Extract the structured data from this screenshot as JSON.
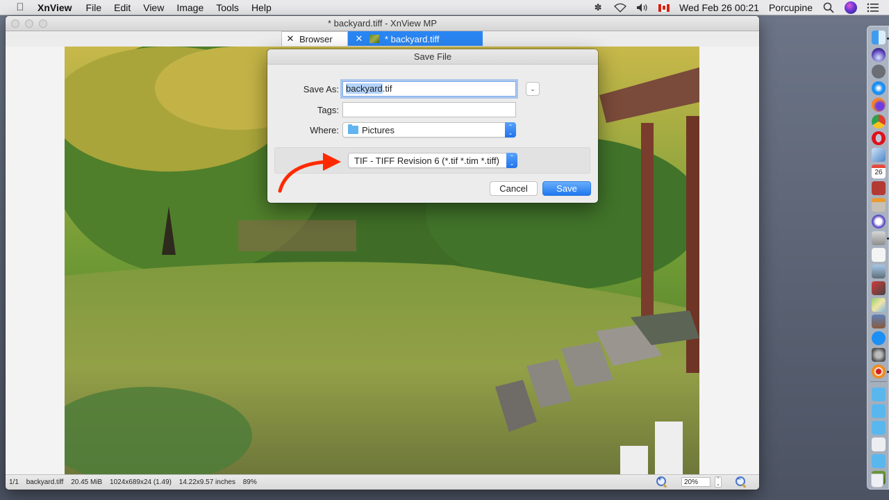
{
  "menubar": {
    "app_name": "XnView",
    "items": [
      "File",
      "Edit",
      "View",
      "Image",
      "Tools",
      "Help"
    ],
    "clock": "Wed Feb 26  00:21",
    "user": "Porcupine",
    "status_icons": [
      "bluetooth-icon",
      "wifi-icon",
      "volume-icon",
      "canada-flag-icon",
      "spotlight-search-icon",
      "siri-icon",
      "notification-center-icon"
    ]
  },
  "window": {
    "title": "* backyard.tiff - XnView MP",
    "tabs": [
      {
        "label": "Browser",
        "active": false
      },
      {
        "label": "* backyard.tiff",
        "active": true
      }
    ]
  },
  "statusbar": {
    "index": "1/1",
    "filename": "backyard.tiff",
    "filesize": "20.45 MiB",
    "dimensions": "1024x689x24 (1.49)",
    "print_size": "14.22x9.57 inches",
    "zoom_percent_display": "89%",
    "zoom_field_value": "20%"
  },
  "dialog": {
    "title": "Save File",
    "save_as_label": "Save As:",
    "save_as_value_selected": "backyard",
    "save_as_value_ext": ".tif",
    "tags_label": "Tags:",
    "tags_value": "",
    "where_label": "Where:",
    "where_value": "Pictures",
    "format_value": "TIF - TIFF Revision 6 (*.tif *.tim *.tiff)",
    "cancel_label": "Cancel",
    "save_label": "Save",
    "accent_color": "#1f78f0",
    "annotation_arrow_color": "#ff2a00"
  },
  "dock": {
    "apps": [
      "Finder",
      "Siri",
      "Launchpad",
      "Safari",
      "Firefox",
      "Chrome",
      "Opera",
      "Preview",
      "Calendar",
      "Dictionary",
      "Calculator",
      "BBEdit",
      "Keynote",
      "TextEdit",
      "Image Capture",
      "Photo Booth",
      "Maps",
      "Photos",
      "App Store",
      "System Preferences",
      "XnView MP"
    ],
    "folders": [
      "Applications",
      "Documents",
      "Downloads",
      "Recent Document",
      "Pictures Stack",
      "backyard image"
    ],
    "calendar_day": "26",
    "calendar_month": "FEB",
    "trash": "Trash"
  }
}
